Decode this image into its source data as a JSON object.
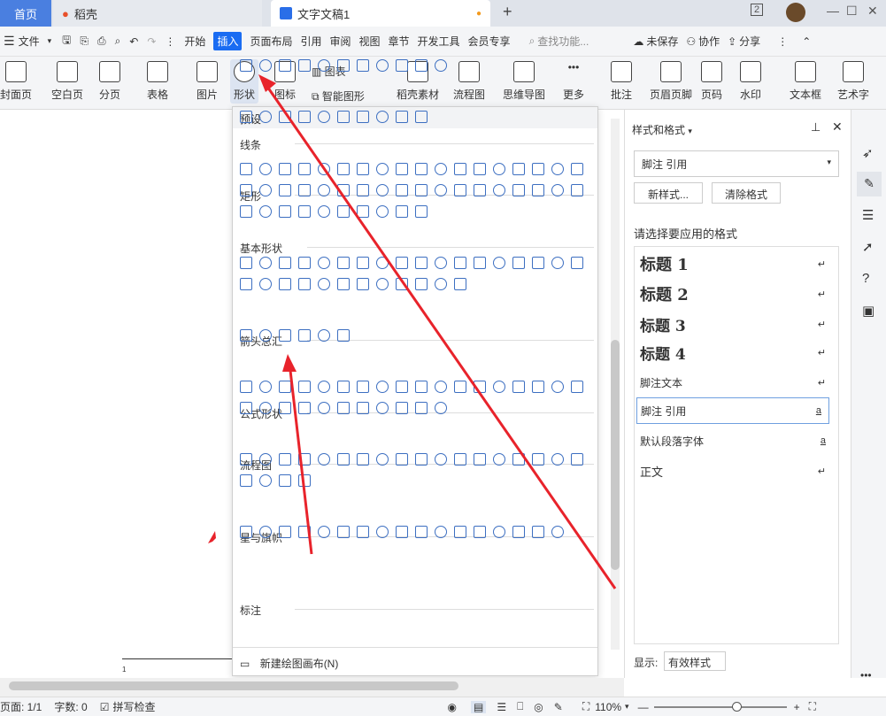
{
  "tabs": {
    "home": "首页",
    "daoke": "稻壳",
    "doc": "文字文稿1",
    "new_tab": "+"
  },
  "window": {
    "page_num": "2"
  },
  "menu": {
    "file": "文件",
    "items": [
      "开始",
      "插入",
      "页面布局",
      "引用",
      "审阅",
      "视图",
      "章节",
      "开发工具",
      "会员专享"
    ],
    "active": "插入",
    "search": "查找功能...",
    "unsaved": "未保存",
    "collab": "协作",
    "share": "分享"
  },
  "ribbon": {
    "cover": "封面页",
    "blank": "空白页",
    "pagebreak": "分页",
    "table": "表格",
    "picture": "图片",
    "shape": "形状",
    "icon": "图标",
    "chart": "图表",
    "smartart": "智能图形",
    "material": "稻壳素材",
    "flowchart": "流程图",
    "mindmap": "思维导图",
    "more": "更多",
    "comment": "批注",
    "headerfooter": "页眉页脚",
    "pagenum": "页码",
    "watermark": "水印",
    "textbox": "文本框",
    "wordart": "艺术字"
  },
  "shapes_panel": {
    "title": "预设",
    "sections": [
      "线条",
      "矩形",
      "基本形状",
      "箭头总汇",
      "公式形状",
      "流程图",
      "星与旗帜",
      "标注"
    ],
    "new_canvas": "新建绘图画布(N)"
  },
  "styles_pane": {
    "title": "样式和格式",
    "current": "脚注 引用",
    "new_style": "新样式...",
    "clear_format": "清除格式",
    "prompt": "请选择要应用的格式",
    "items": [
      "标题 1",
      "标题 2",
      "标题 3",
      "标题 4",
      "脚注文本",
      "脚注 引用",
      "默认段落字体",
      "正文"
    ],
    "show_label": "显示:",
    "show_value": "有效样式"
  },
  "ruler": {
    "page_marker": "1"
  },
  "status": {
    "page": "页面: 1/1",
    "words": "字数: 0",
    "spell": "拼写检查",
    "zoom": "110%"
  },
  "colors": {
    "accent": "#1a6cf2",
    "home_tab": "#4a7fe0",
    "shape_stroke": "#3d6fc1",
    "arrow": "#e8232b"
  }
}
